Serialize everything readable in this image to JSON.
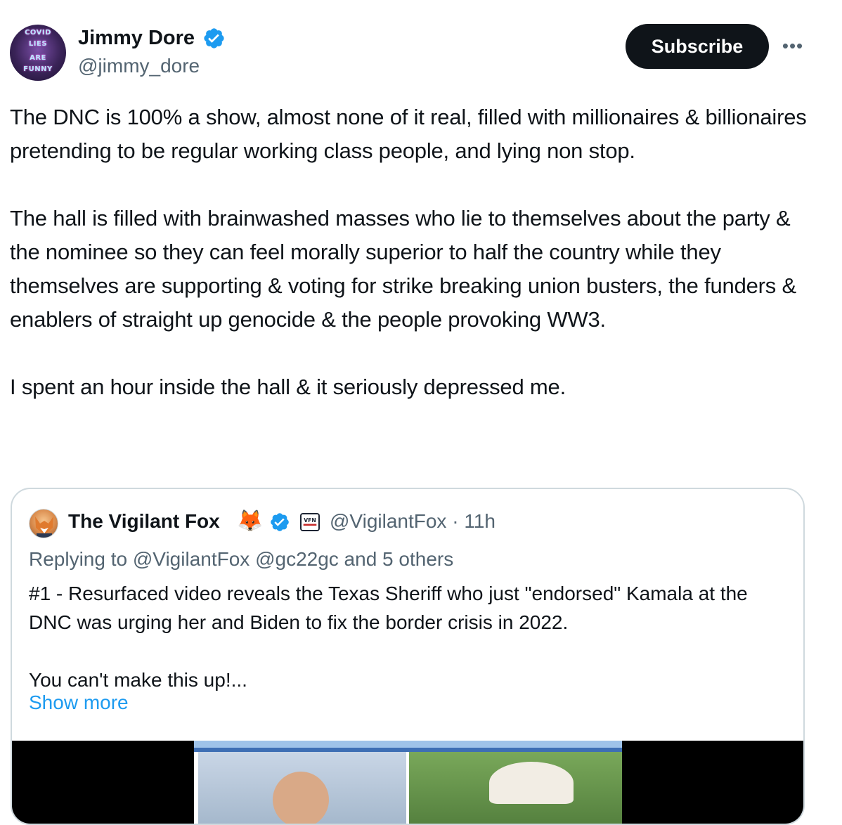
{
  "author": {
    "name": "Jimmy Dore",
    "handle": "@jimmy_dore",
    "avatar_words": [
      "COVID",
      "LIES",
      "ARE",
      "FUNNY"
    ]
  },
  "actions": {
    "subscribe_label": "Subscribe",
    "more_label": "•••"
  },
  "tweet": {
    "text": "The DNC is 100% a show, almost none of it real, filled with millionaires & billionaires pretending to be regular working class people, and lying non stop.\n\nThe hall is filled with brainwashed masses who lie to themselves about the party & the nominee so they can feel morally superior to half the country while they themselves are supporting & voting for strike breaking union busters, the funders & enablers of straight up genocide & the people provoking WW3.\n\nI spent an hour inside the hall & it seriously depressed me."
  },
  "quoted_tweet": {
    "name": "The Vigilant Fox",
    "emoji": "🦊",
    "handle": "@VigilantFox",
    "time": "11h",
    "affiliate_badge": "VFN",
    "replying_to": "Replying to @VigilantFox @gc22gc and 5 others",
    "text": "#1 - Resurfaced video reveals the Texas Sheriff who just \"endorsed\" Kamala at the DNC was urging her and Biden to fix the border crisis in 2022.\n\nYou can't make this up!...",
    "show_more": "Show more"
  },
  "colors": {
    "text": "#0f1419",
    "secondary": "#536471",
    "link": "#1d9bf0",
    "verified": "#1d9bf0",
    "button_bg": "#0f1419",
    "border": "#cfd9de"
  },
  "icons": {
    "verified": "verified-badge-icon",
    "more": "more-options-icon"
  }
}
